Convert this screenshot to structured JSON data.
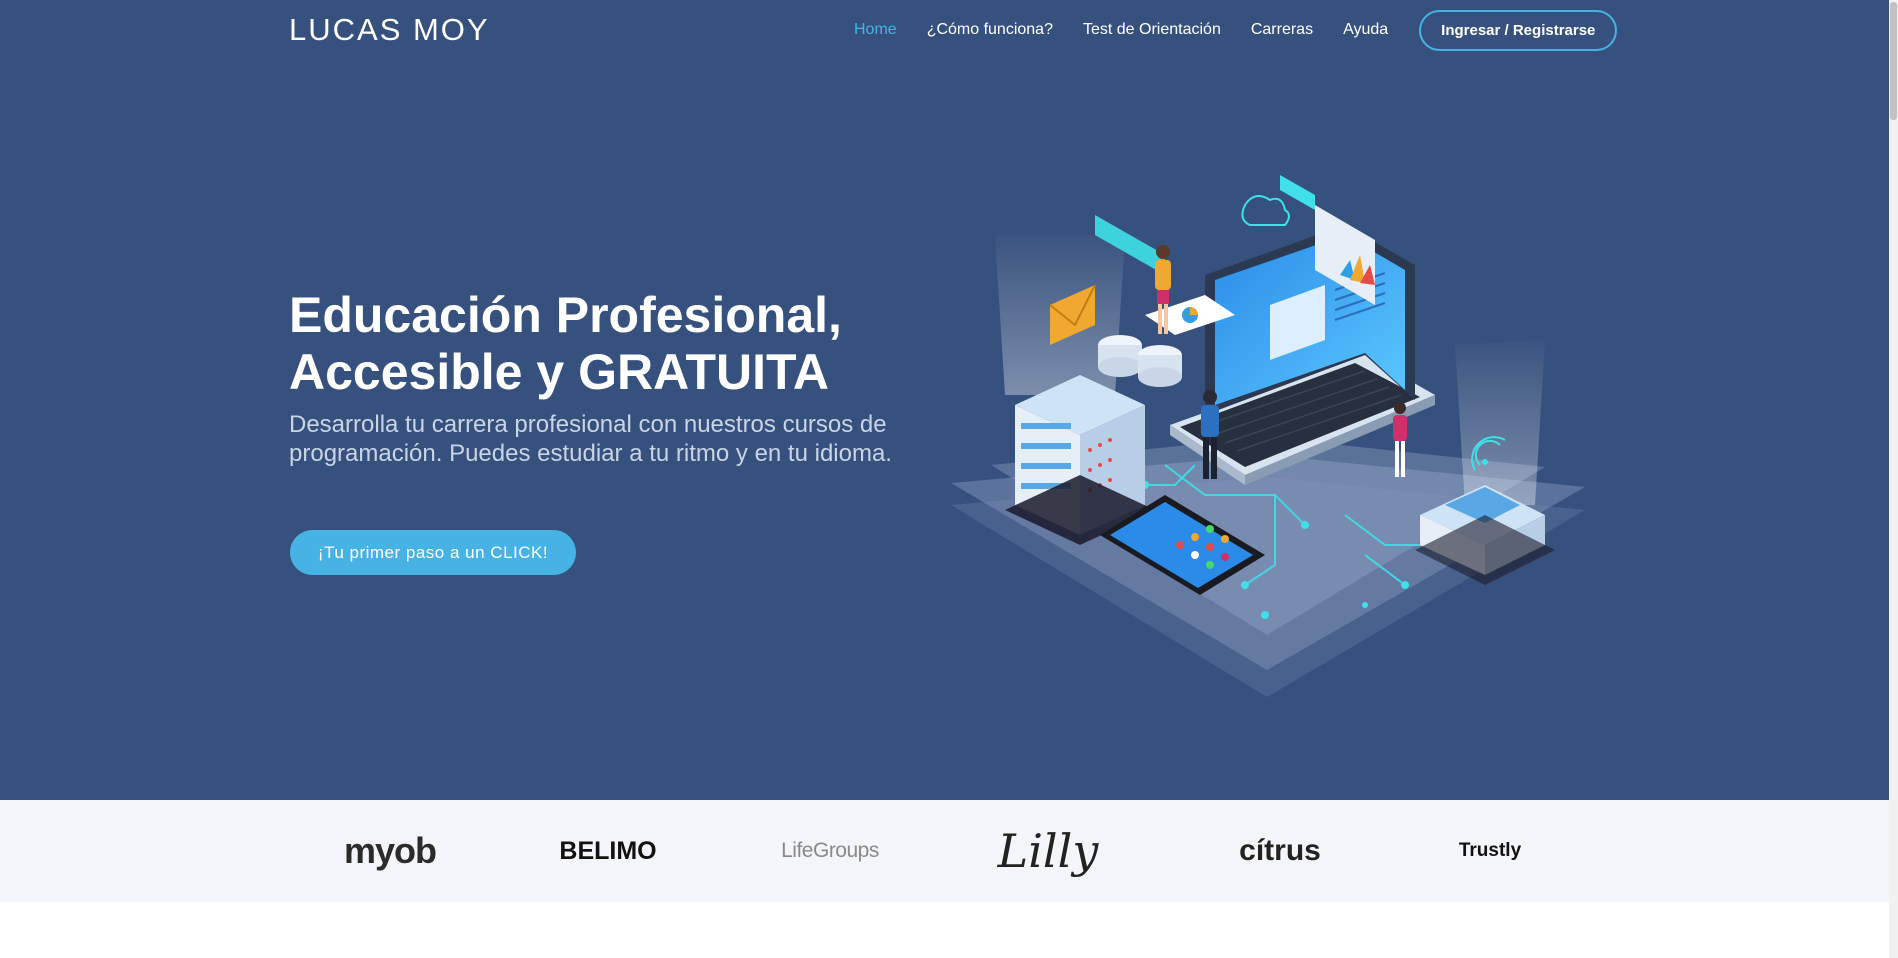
{
  "header": {
    "logo": "LUCAS MOY",
    "nav": [
      {
        "label": "Home",
        "active": true
      },
      {
        "label": "¿Cómo funciona?"
      },
      {
        "label": "Test de Orientación"
      },
      {
        "label": "Carreras"
      },
      {
        "label": "Ayuda"
      }
    ],
    "login_label": "Ingresar / Registrarse"
  },
  "hero": {
    "title_line1": "Educación Profesional,",
    "title_line2": "Accesible y GRATUITA",
    "subtitle": "Desarrolla tu carrera profesional con nuestros cursos de programación. Puedes estudiar a tu ritmo y en tu idioma.",
    "cta_label": "¡Tu primer paso a un CLICK!",
    "illustration": "isometric-tech-illustration"
  },
  "clients": [
    {
      "name": "myob"
    },
    {
      "name": "BELIMO"
    },
    {
      "name": "LifeGroups"
    },
    {
      "name": "Lilly"
    },
    {
      "name": "cítrus"
    },
    {
      "name": "Trustly"
    }
  ],
  "colors": {
    "hero_bg": "#37517e",
    "accent": "#47b2e4",
    "clients_bg": "#f3f5fa"
  }
}
